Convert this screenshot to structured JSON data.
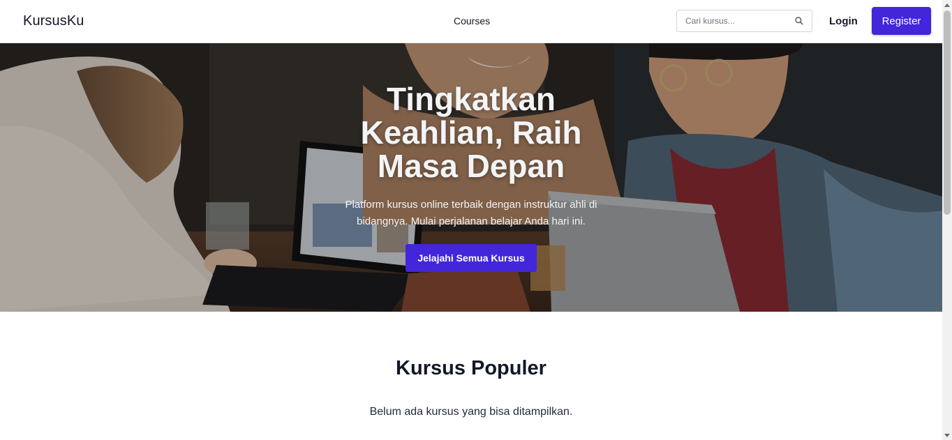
{
  "navbar": {
    "brand": "KursusKu",
    "courses_link": "Courses",
    "search": {
      "placeholder": "Cari kursus...",
      "value": ""
    },
    "login_label": "Login",
    "register_label": "Register"
  },
  "hero": {
    "title_lines": [
      "Tingkatkan",
      "Keahlian, Raih",
      "Masa Depan"
    ],
    "subtitle": "Platform kursus online terbaik dengan instruktur ahli di bidangnya. Mulai perjalanan belajar Anda hari ini.",
    "cta_label": "Jelajahi Semua Kursus",
    "background_image": "photo-people-studying-with-laptops"
  },
  "popular": {
    "title": "Kursus Populer",
    "empty_message": "Belum ada kursus yang bisa ditampilkan."
  },
  "icons": {
    "search": "search-icon",
    "scroll_up": "chevron-up-icon",
    "scroll_down": "chevron-down-icon"
  },
  "colors": {
    "accent": "#4326d9",
    "text": "#111827",
    "background": "#ffffff"
  }
}
